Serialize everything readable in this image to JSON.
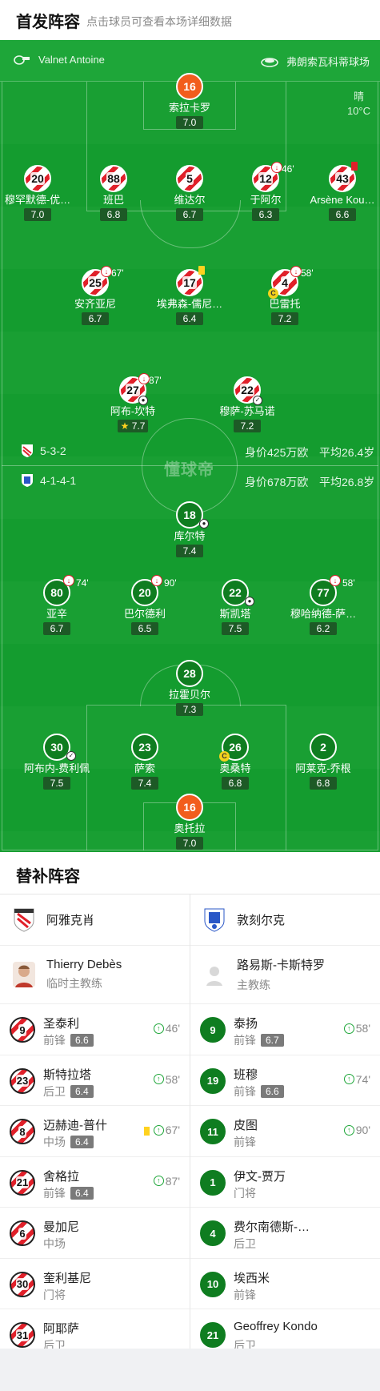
{
  "header": {
    "title": "首发阵容",
    "subtitle": "点击球员可查看本场详细数据"
  },
  "pitch": {
    "referee": "Valnet Antoine",
    "stadium": "弗朗索瓦科蒂球场",
    "weather": "晴",
    "temperature": "10°C",
    "watermark": "懂球帝"
  },
  "home_team": {
    "formation": "5-3-2",
    "value": "身价425万欧",
    "avg_age": "平均26.4岁",
    "players": [
      {
        "num": "16",
        "name": "索拉卡罗",
        "rating": "7.0",
        "role": "gk"
      },
      {
        "num": "20",
        "name": "穆罕默德-优…",
        "rating": "7.0"
      },
      {
        "num": "88",
        "name": "班巴",
        "rating": "6.8"
      },
      {
        "num": "5",
        "name": "维达尔",
        "rating": "6.7"
      },
      {
        "num": "12",
        "name": "于阿尔",
        "rating": "6.3",
        "sub_out": "46'"
      },
      {
        "num": "43",
        "name": "Arsène Kou…",
        "rating": "6.6"
      },
      {
        "num": "25",
        "name": "安齐亚尼",
        "rating": "6.7",
        "sub_out": "67'"
      },
      {
        "num": "17",
        "name": "埃弗森-儒尼…",
        "rating": "6.4"
      },
      {
        "num": "4",
        "name": "巴雷托",
        "rating": "7.2",
        "sub_out": "58'"
      },
      {
        "num": "27",
        "name": "阿布-坎特",
        "rating": "7.7",
        "sub_out": "87'"
      },
      {
        "num": "22",
        "name": "穆萨-苏马诺",
        "rating": "7.2"
      }
    ]
  },
  "away_team": {
    "formation": "4-1-4-1",
    "value": "身价678万欧",
    "avg_age": "平均26.8岁",
    "players": [
      {
        "num": "18",
        "name": "库尔特",
        "rating": "7.4"
      },
      {
        "num": "80",
        "name": "亚辛",
        "rating": "6.7",
        "sub_out": "74'"
      },
      {
        "num": "20",
        "name": "巴尔德利",
        "rating": "6.5",
        "sub_out": "90'"
      },
      {
        "num": "22",
        "name": "斯凯塔",
        "rating": "7.5"
      },
      {
        "num": "77",
        "name": "穆哈纳德-萨…",
        "rating": "6.2",
        "sub_out": "58'"
      },
      {
        "num": "28",
        "name": "拉霍贝尔",
        "rating": "7.3"
      },
      {
        "num": "30",
        "name": "阿布内-费利佩",
        "rating": "7.5"
      },
      {
        "num": "23",
        "name": "萨索",
        "rating": "7.4"
      },
      {
        "num": "26",
        "name": "奥桑特",
        "rating": "6.8"
      },
      {
        "num": "2",
        "name": "阿莱克-乔根",
        "rating": "6.8"
      },
      {
        "num": "16",
        "name": "奥托拉",
        "rating": "7.0",
        "role": "gk"
      }
    ]
  },
  "subs": {
    "title": "替补阵容",
    "home": {
      "team_name": "阿雅克肖",
      "coach_name": "Thierry Debès",
      "coach_role": "临时主教练",
      "players": [
        {
          "num": "9",
          "name": "圣泰利",
          "pos": "前锋",
          "rating": "6.6",
          "in": "46'"
        },
        {
          "num": "23",
          "name": "斯特拉塔",
          "pos": "后卫",
          "rating": "6.4",
          "in": "58'"
        },
        {
          "num": "8",
          "name": "迈赫迪-普什",
          "pos": "中场",
          "rating": "6.4",
          "in": "67'",
          "yellow": true
        },
        {
          "num": "21",
          "name": "舍格拉",
          "pos": "前锋",
          "rating": "6.4",
          "in": "87'"
        },
        {
          "num": "6",
          "name": "曼加尼",
          "pos": "中场"
        },
        {
          "num": "30",
          "name": "奎利基尼",
          "pos": "门将"
        },
        {
          "num": "31",
          "name": "阿耶萨",
          "pos": "后卫"
        }
      ]
    },
    "away": {
      "team_name": "敦刻尔克",
      "coach_name": "路易斯-卡斯特罗",
      "coach_role": "主教练",
      "players": [
        {
          "num": "9",
          "name": "泰扬",
          "pos": "前锋",
          "rating": "6.7",
          "in": "58'"
        },
        {
          "num": "19",
          "name": "班穆",
          "pos": "前锋",
          "rating": "6.6",
          "in": "74'"
        },
        {
          "num": "11",
          "name": "皮图",
          "pos": "前锋",
          "in": "90'"
        },
        {
          "num": "1",
          "name": "伊文-贾万",
          "pos": "门将"
        },
        {
          "num": "4",
          "name": "费尔南德斯-…",
          "pos": "后卫"
        },
        {
          "num": "10",
          "name": "埃西米",
          "pos": "前锋"
        },
        {
          "num": "21",
          "name": "Geoffrey Kondo",
          "pos": "后卫"
        }
      ]
    }
  },
  "colors": {
    "pitch": "#149c2f",
    "home_stripe": "#e0202a",
    "away": "#0f7d20",
    "gk": "#f25d1d",
    "sub_in": "#1ea639"
  }
}
